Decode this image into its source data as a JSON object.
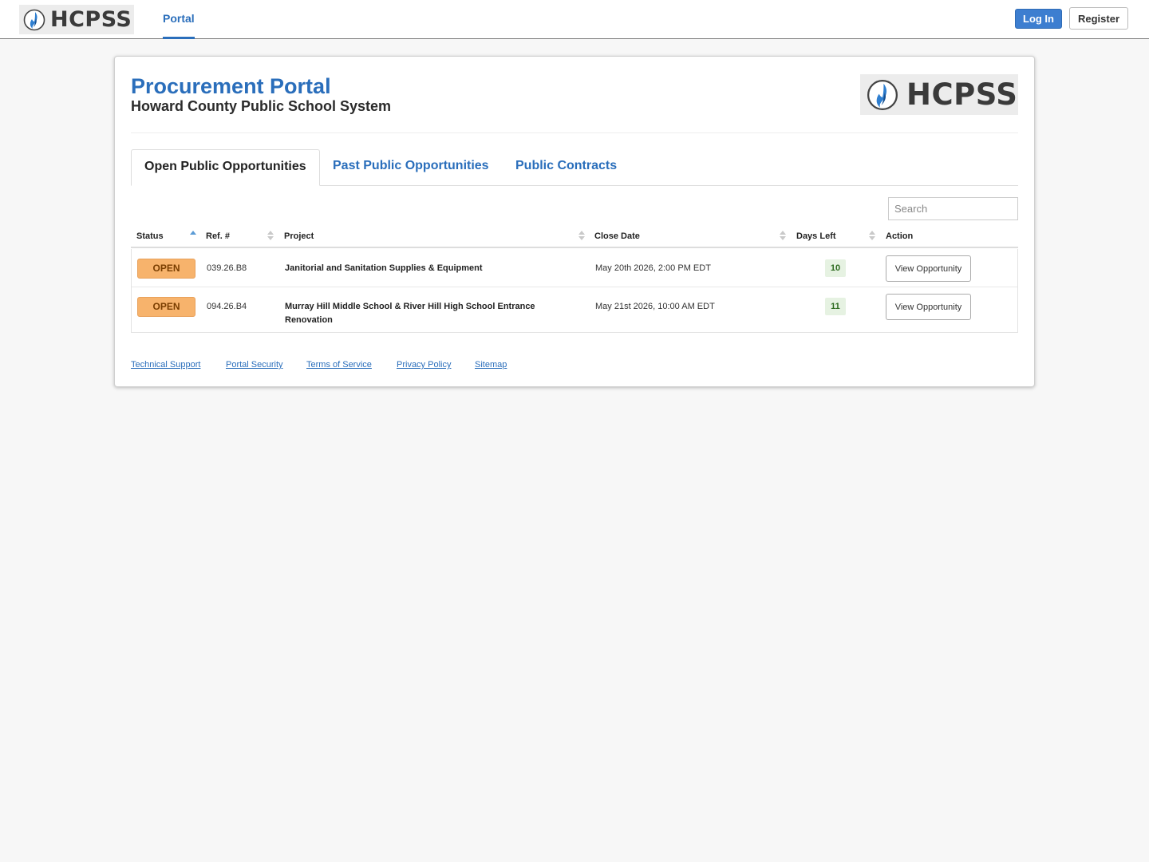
{
  "header": {
    "brand": "HCPSS",
    "nav": [
      {
        "label": "Portal"
      }
    ],
    "login_label": "Log In",
    "register_label": "Register"
  },
  "page": {
    "title": "Procurement Portal",
    "subtitle": "Howard County Public School System",
    "logo_text": "HCPSS"
  },
  "tabs": [
    {
      "label": "Open Public Opportunities",
      "active": true
    },
    {
      "label": "Past Public Opportunities",
      "active": false
    },
    {
      "label": "Public Contracts",
      "active": false
    }
  ],
  "search": {
    "placeholder": "Search"
  },
  "table": {
    "columns": [
      "Status",
      "Ref. #",
      "Project",
      "Close Date",
      "Days Left",
      "Action"
    ],
    "sorted_column": "Status",
    "rows": [
      {
        "status": "OPEN",
        "ref": "039.26.B8",
        "project": "Janitorial and Sanitation Supplies & Equipment",
        "close_date": "May 20th 2026, 2:00 PM EDT",
        "days_left": "10",
        "action": "View Opportunity"
      },
      {
        "status": "OPEN",
        "ref": "094.26.B4",
        "project": "Murray Hill Middle School & River Hill High School Entrance Renovation",
        "close_date": "May 21st 2026, 10:00 AM EDT",
        "days_left": "11",
        "action": "View Opportunity"
      }
    ]
  },
  "footer": {
    "links": [
      "Technical Support",
      "Portal Security",
      "Terms of Service",
      "Privacy Policy",
      "Sitemap"
    ]
  },
  "colors": {
    "accent": "#2a6ebb",
    "login_button": "#3d7ed0",
    "open_badge": "#f7b36c",
    "days_badge": "#e6f2e2"
  },
  "icons": {
    "brand_logo": "flame-logo-icon",
    "sort": "sort-arrows-icon"
  }
}
